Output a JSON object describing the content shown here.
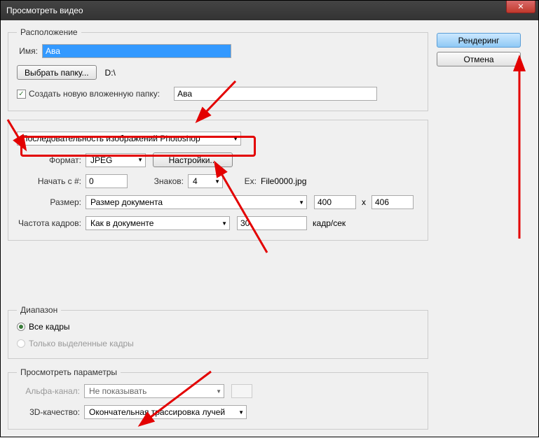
{
  "window": {
    "title": "Просмотреть видео"
  },
  "sidebar": {
    "render": "Рендеринг",
    "cancel": "Отмена"
  },
  "location": {
    "legend": "Расположение",
    "name_label": "Имя:",
    "name_value": "Ава",
    "browse_btn": "Выбрать папку...",
    "path": "D:\\",
    "create_sub_label": "Создать новую вложенную папку:",
    "create_sub_value": "Ава"
  },
  "options": {
    "sequence_type": "Последовательность изображений Photoshop",
    "format_label": "Формат:",
    "format_value": "JPEG",
    "settings_btn": "Настройки...",
    "start_label": "Начать с #:",
    "start_value": "0",
    "digits_label": "Знаков:",
    "digits_value": "4",
    "example_label": "Ex:",
    "example_value": "File0000.jpg",
    "size_label": "Размер:",
    "size_value": "Размер документа",
    "width": "400",
    "x": "x",
    "height": "406",
    "fps_label": "Частота кадров:",
    "fps_value": "Как в документе",
    "fps_num": "30",
    "fps_unit": "кадр/сек"
  },
  "range": {
    "legend": "Диапазон",
    "all": "Все кадры",
    "selected": "Только выделенные кадры"
  },
  "preview": {
    "legend": "Просмотреть параметры",
    "alpha_label": "Альфа-канал:",
    "alpha_value": "Не показывать",
    "quality_label": "3D-качество:",
    "quality_value": "Окончательная трассировка лучей"
  }
}
